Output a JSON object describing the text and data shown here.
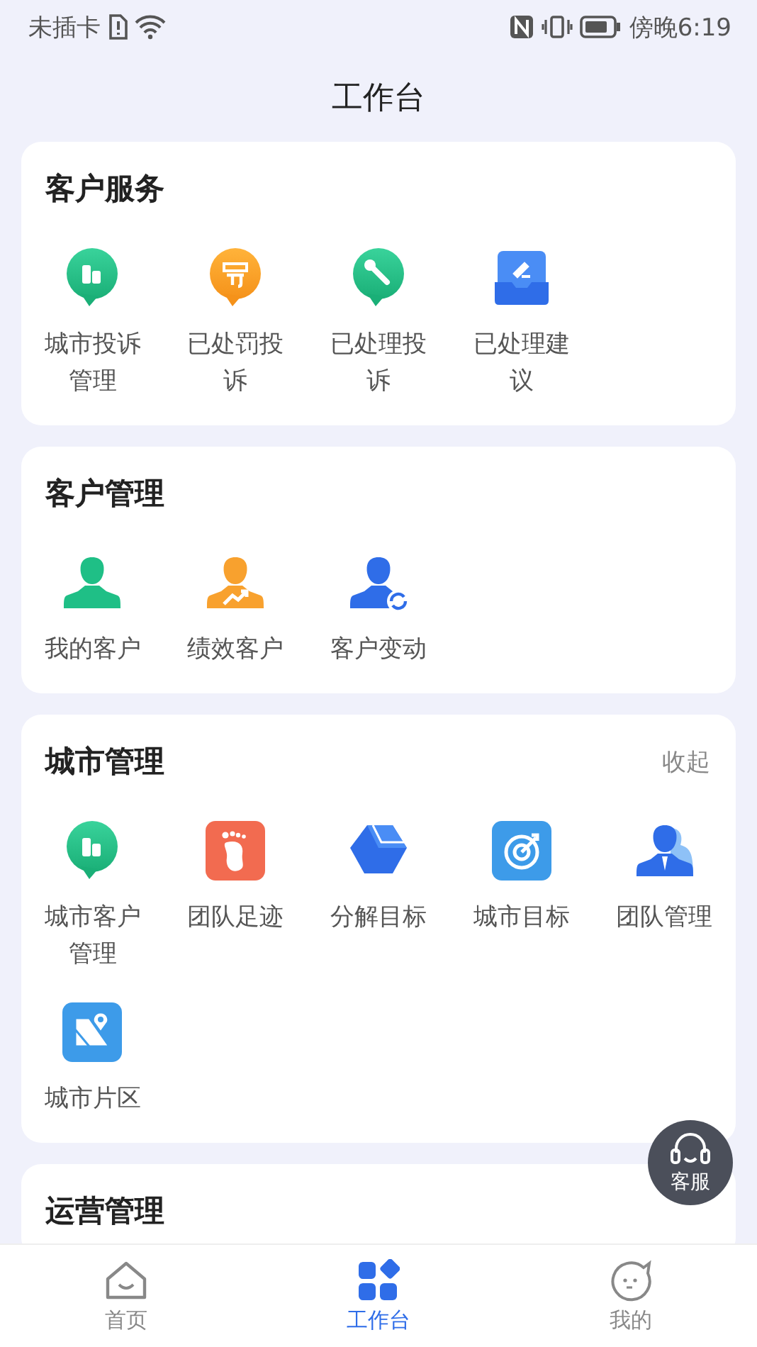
{
  "status_bar": {
    "carrier": "未插卡",
    "time": "傍晚6:19"
  },
  "header": {
    "title": "工作台"
  },
  "sections": [
    {
      "title": "客户服务",
      "items": [
        {
          "label": "城市投诉管理",
          "kind": "bubble-chart"
        },
        {
          "label": "已处罚投诉",
          "kind": "bubble-stamp"
        },
        {
          "label": "已处理投诉",
          "kind": "bubble-wrench"
        },
        {
          "label": "已处理建议",
          "kind": "tray-pen"
        }
      ]
    },
    {
      "title": "客户管理",
      "items": [
        {
          "label": "我的客户",
          "kind": "person-green"
        },
        {
          "label": "绩效客户",
          "kind": "person-trend"
        },
        {
          "label": "客户变动",
          "kind": "person-swap"
        }
      ]
    },
    {
      "title": "城市管理",
      "action": "收起",
      "items": [
        {
          "label": "城市客户管理",
          "kind": "bubble-chart"
        },
        {
          "label": "团队足迹",
          "kind": "footprint"
        },
        {
          "label": "分解目标",
          "kind": "cube"
        },
        {
          "label": "城市目标",
          "kind": "target"
        },
        {
          "label": "团队管理",
          "kind": "team"
        },
        {
          "label": "城市片区",
          "kind": "map"
        }
      ]
    },
    {
      "title": "运营管理"
    }
  ],
  "float_button": {
    "label": "客服"
  },
  "tabs": [
    {
      "label": "首页",
      "kind": "home",
      "selected": false
    },
    {
      "label": "工作台",
      "kind": "grid",
      "selected": true
    },
    {
      "label": "我的",
      "kind": "face",
      "selected": false
    }
  ]
}
